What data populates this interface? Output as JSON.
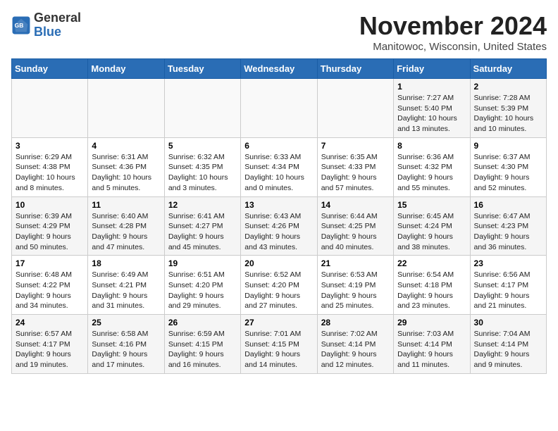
{
  "logo": {
    "text_general": "General",
    "text_blue": "Blue"
  },
  "title": "November 2024",
  "location": "Manitowoc, Wisconsin, United States",
  "days_of_week": [
    "Sunday",
    "Monday",
    "Tuesday",
    "Wednesday",
    "Thursday",
    "Friday",
    "Saturday"
  ],
  "weeks": [
    [
      {
        "day": "",
        "info": ""
      },
      {
        "day": "",
        "info": ""
      },
      {
        "day": "",
        "info": ""
      },
      {
        "day": "",
        "info": ""
      },
      {
        "day": "",
        "info": ""
      },
      {
        "day": "1",
        "info": "Sunrise: 7:27 AM\nSunset: 5:40 PM\nDaylight: 10 hours and 13 minutes."
      },
      {
        "day": "2",
        "info": "Sunrise: 7:28 AM\nSunset: 5:39 PM\nDaylight: 10 hours and 10 minutes."
      }
    ],
    [
      {
        "day": "3",
        "info": "Sunrise: 6:29 AM\nSunset: 4:38 PM\nDaylight: 10 hours and 8 minutes."
      },
      {
        "day": "4",
        "info": "Sunrise: 6:31 AM\nSunset: 4:36 PM\nDaylight: 10 hours and 5 minutes."
      },
      {
        "day": "5",
        "info": "Sunrise: 6:32 AM\nSunset: 4:35 PM\nDaylight: 10 hours and 3 minutes."
      },
      {
        "day": "6",
        "info": "Sunrise: 6:33 AM\nSunset: 4:34 PM\nDaylight: 10 hours and 0 minutes."
      },
      {
        "day": "7",
        "info": "Sunrise: 6:35 AM\nSunset: 4:33 PM\nDaylight: 9 hours and 57 minutes."
      },
      {
        "day": "8",
        "info": "Sunrise: 6:36 AM\nSunset: 4:32 PM\nDaylight: 9 hours and 55 minutes."
      },
      {
        "day": "9",
        "info": "Sunrise: 6:37 AM\nSunset: 4:30 PM\nDaylight: 9 hours and 52 minutes."
      }
    ],
    [
      {
        "day": "10",
        "info": "Sunrise: 6:39 AM\nSunset: 4:29 PM\nDaylight: 9 hours and 50 minutes."
      },
      {
        "day": "11",
        "info": "Sunrise: 6:40 AM\nSunset: 4:28 PM\nDaylight: 9 hours and 47 minutes."
      },
      {
        "day": "12",
        "info": "Sunrise: 6:41 AM\nSunset: 4:27 PM\nDaylight: 9 hours and 45 minutes."
      },
      {
        "day": "13",
        "info": "Sunrise: 6:43 AM\nSunset: 4:26 PM\nDaylight: 9 hours and 43 minutes."
      },
      {
        "day": "14",
        "info": "Sunrise: 6:44 AM\nSunset: 4:25 PM\nDaylight: 9 hours and 40 minutes."
      },
      {
        "day": "15",
        "info": "Sunrise: 6:45 AM\nSunset: 4:24 PM\nDaylight: 9 hours and 38 minutes."
      },
      {
        "day": "16",
        "info": "Sunrise: 6:47 AM\nSunset: 4:23 PM\nDaylight: 9 hours and 36 minutes."
      }
    ],
    [
      {
        "day": "17",
        "info": "Sunrise: 6:48 AM\nSunset: 4:22 PM\nDaylight: 9 hours and 34 minutes."
      },
      {
        "day": "18",
        "info": "Sunrise: 6:49 AM\nSunset: 4:21 PM\nDaylight: 9 hours and 31 minutes."
      },
      {
        "day": "19",
        "info": "Sunrise: 6:51 AM\nSunset: 4:20 PM\nDaylight: 9 hours and 29 minutes."
      },
      {
        "day": "20",
        "info": "Sunrise: 6:52 AM\nSunset: 4:20 PM\nDaylight: 9 hours and 27 minutes."
      },
      {
        "day": "21",
        "info": "Sunrise: 6:53 AM\nSunset: 4:19 PM\nDaylight: 9 hours and 25 minutes."
      },
      {
        "day": "22",
        "info": "Sunrise: 6:54 AM\nSunset: 4:18 PM\nDaylight: 9 hours and 23 minutes."
      },
      {
        "day": "23",
        "info": "Sunrise: 6:56 AM\nSunset: 4:17 PM\nDaylight: 9 hours and 21 minutes."
      }
    ],
    [
      {
        "day": "24",
        "info": "Sunrise: 6:57 AM\nSunset: 4:17 PM\nDaylight: 9 hours and 19 minutes."
      },
      {
        "day": "25",
        "info": "Sunrise: 6:58 AM\nSunset: 4:16 PM\nDaylight: 9 hours and 17 minutes."
      },
      {
        "day": "26",
        "info": "Sunrise: 6:59 AM\nSunset: 4:15 PM\nDaylight: 9 hours and 16 minutes."
      },
      {
        "day": "27",
        "info": "Sunrise: 7:01 AM\nSunset: 4:15 PM\nDaylight: 9 hours and 14 minutes."
      },
      {
        "day": "28",
        "info": "Sunrise: 7:02 AM\nSunset: 4:14 PM\nDaylight: 9 hours and 12 minutes."
      },
      {
        "day": "29",
        "info": "Sunrise: 7:03 AM\nSunset: 4:14 PM\nDaylight: 9 hours and 11 minutes."
      },
      {
        "day": "30",
        "info": "Sunrise: 7:04 AM\nSunset: 4:14 PM\nDaylight: 9 hours and 9 minutes."
      }
    ]
  ]
}
